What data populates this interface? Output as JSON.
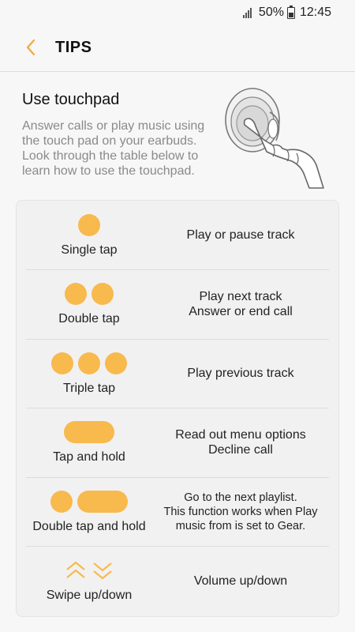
{
  "status_bar": {
    "battery": "50%",
    "time": "12:45"
  },
  "app_bar": {
    "title": "TIPS"
  },
  "intro": {
    "title": "Use touchpad",
    "description": "Answer calls or play music using the touch pad on your earbuds. Look through the table below to learn how to use the touchpad."
  },
  "gestures": [
    {
      "label": "Single tap",
      "icon": "single-dot",
      "actions": [
        "Play or pause track"
      ]
    },
    {
      "label": "Double tap",
      "icon": "double-dot",
      "actions": [
        "Play next track",
        "Answer or end call"
      ]
    },
    {
      "label": "Triple tap",
      "icon": "triple-dot",
      "actions": [
        "Play previous track"
      ]
    },
    {
      "label": "Tap and hold",
      "icon": "pill",
      "actions": [
        "Read out menu options",
        "Decline call"
      ]
    },
    {
      "label": "Double tap and hold",
      "icon": "dot-pill",
      "actions": [
        "Go to the next playlist.",
        "This function works when Play",
        "music from is set to Gear."
      ]
    },
    {
      "label": "Swipe up/down",
      "icon": "chevrons-up-down",
      "actions": [
        "Volume up/down"
      ]
    }
  ],
  "colors": {
    "accent": "#f8b94d",
    "back_arrow": "#f3a93a"
  }
}
